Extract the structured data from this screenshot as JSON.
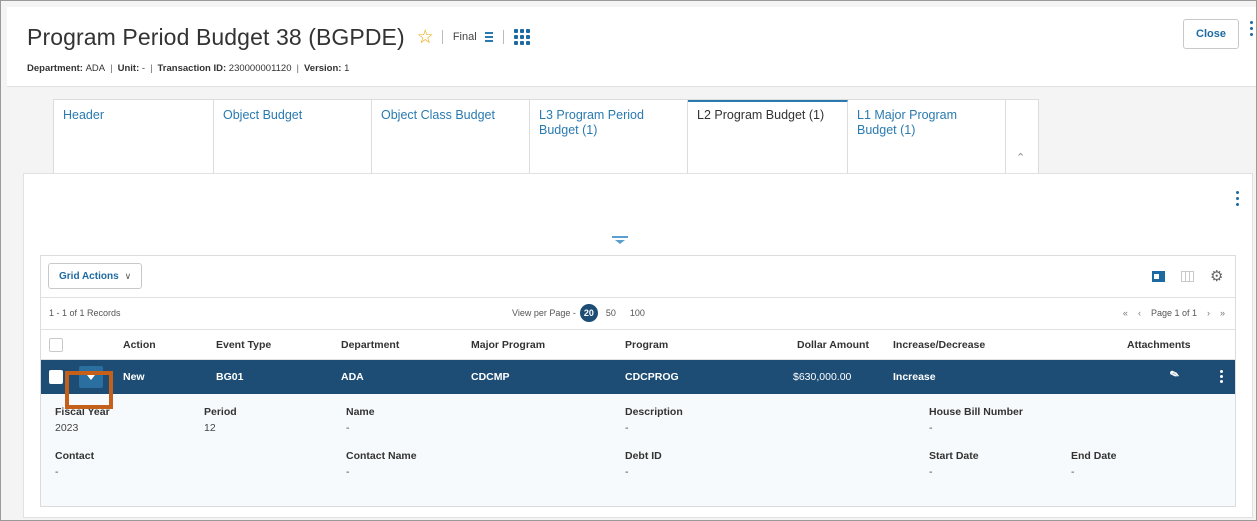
{
  "header": {
    "title": "Program Period Budget 38 (BGPDE)",
    "status": "Final",
    "meta": [
      {
        "label": "Department:",
        "value": "ADA"
      },
      {
        "label": "Unit:",
        "value": "-"
      },
      {
        "label": "Transaction ID:",
        "value": "230000001120"
      },
      {
        "label": "Version:",
        "value": "1"
      }
    ],
    "close_label": "Close"
  },
  "tabs": [
    {
      "label": "Header",
      "active": false
    },
    {
      "label": "Object Budget",
      "active": false
    },
    {
      "label": "Object Class Budget",
      "active": false
    },
    {
      "label": "L3 Program Period Budget (1)",
      "active": false
    },
    {
      "label": "L2 Program Budget (1)",
      "active": true
    },
    {
      "label": "L1 Major Program Budget (1)",
      "active": false
    }
  ],
  "grid": {
    "actions_label": "Grid Actions",
    "record_count": "1 - 1 of 1 Records",
    "view_per_page_label": "View per Page -",
    "page_sizes": [
      "20",
      "50",
      "100"
    ],
    "page_size_selected": "20",
    "page_label": "Page 1 of 1",
    "columns": [
      "Action",
      "Event Type",
      "Department",
      "Major Program",
      "Program",
      "Dollar Amount",
      "Increase/Decrease",
      "Attachments"
    ],
    "row": {
      "action": "New",
      "event_type": "BG01",
      "department": "ADA",
      "major_program": "CDCMP",
      "program": "CDCPROG",
      "dollar_amount": "$630,000.00",
      "increase_decrease": "Increase"
    },
    "detail": {
      "fiscal_year": {
        "label": "Fiscal Year",
        "value": "2023"
      },
      "period": {
        "label": "Period",
        "value": "12"
      },
      "name": {
        "label": "Name",
        "value": "-"
      },
      "description": {
        "label": "Description",
        "value": "-"
      },
      "house_bill_number": {
        "label": "House Bill Number",
        "value": "-"
      },
      "contact": {
        "label": "Contact",
        "value": "-"
      },
      "contact_name": {
        "label": "Contact Name",
        "value": "-"
      },
      "debt_id": {
        "label": "Debt ID",
        "value": "-"
      },
      "start_date": {
        "label": "Start Date",
        "value": "-"
      },
      "end_date": {
        "label": "End Date",
        "value": "-"
      }
    }
  },
  "colors": {
    "accent": "#1d6aa3",
    "row_selected": "#1d4d74",
    "highlight": "#c4601a",
    "star": "#e8a400"
  }
}
